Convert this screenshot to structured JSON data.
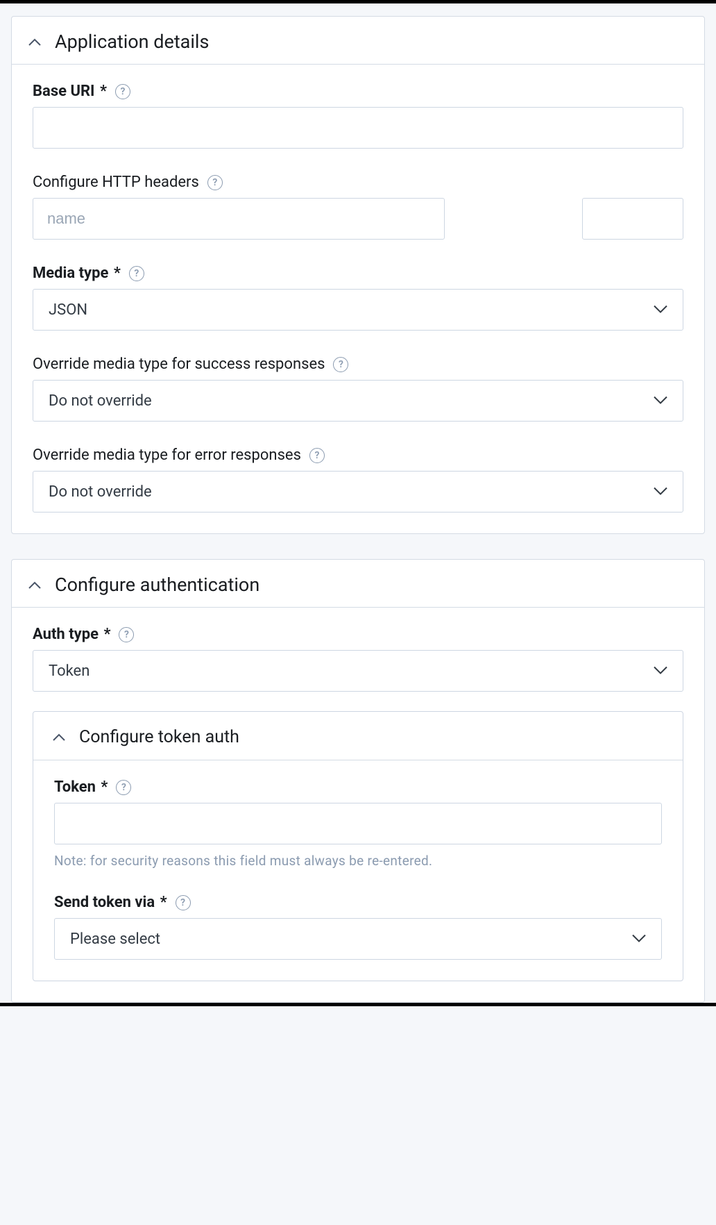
{
  "sections": {
    "app_details": {
      "title": "Application details",
      "fields": {
        "base_uri": {
          "label": "Base URI",
          "required_mark": "*",
          "value": ""
        },
        "http_headers": {
          "label": "Configure HTTP headers",
          "name_placeholder": "name"
        },
        "media_type": {
          "label": "Media type",
          "required_mark": "*",
          "value": "JSON"
        },
        "override_success": {
          "label": "Override media type for success responses",
          "value": "Do not override"
        },
        "override_error": {
          "label": "Override media type for error responses",
          "value": "Do not override"
        }
      }
    },
    "config_auth": {
      "title": "Configure authentication",
      "fields": {
        "auth_type": {
          "label": "Auth type",
          "required_mark": "*",
          "value": "Token"
        }
      },
      "token_auth": {
        "title": "Configure token auth",
        "fields": {
          "token": {
            "label": "Token",
            "required_mark": "*",
            "value": "",
            "note": "Note: for security reasons this field must always be re-entered."
          },
          "send_via": {
            "label": "Send token via",
            "required_mark": "*",
            "value": "Please select"
          }
        }
      }
    }
  },
  "help_glyph": "?"
}
